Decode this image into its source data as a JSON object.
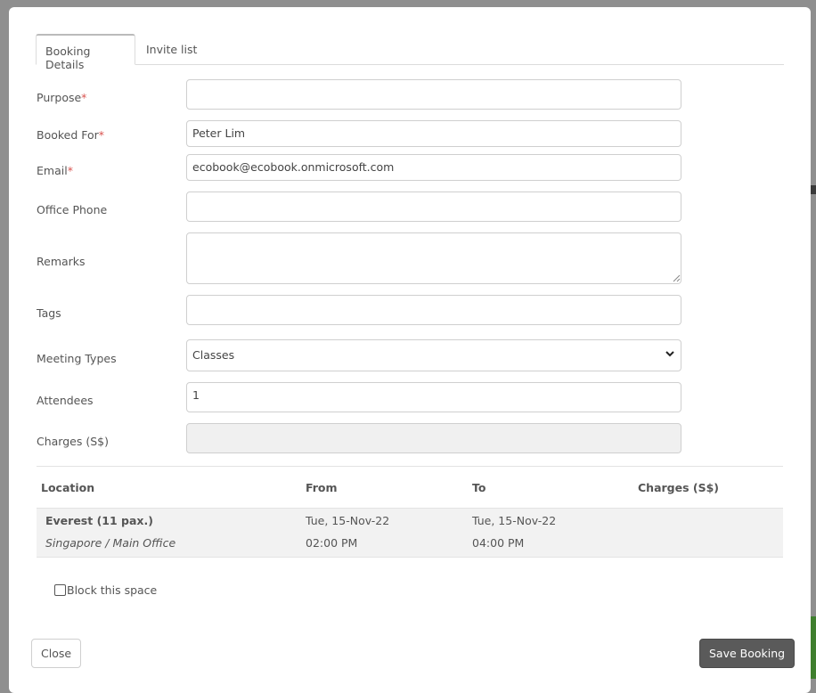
{
  "tabs": [
    {
      "label": "Booking Details",
      "active": true
    },
    {
      "label": "Invite list",
      "active": false
    }
  ],
  "form": {
    "purpose": {
      "label": "Purpose",
      "required": "*",
      "value": ""
    },
    "booked_for": {
      "label": "Booked For",
      "required": "*",
      "value": "Peter Lim"
    },
    "email": {
      "label": "Email",
      "required": "*",
      "value": "ecobook@ecobook.onmicrosoft.com"
    },
    "office_phone": {
      "label": "Office Phone",
      "value": ""
    },
    "remarks": {
      "label": "Remarks",
      "value": ""
    },
    "tags": {
      "label": "Tags",
      "value": ""
    },
    "meeting_types": {
      "label": "Meeting Types",
      "value": "Classes"
    },
    "attendees": {
      "label": "Attendees",
      "value": "1"
    },
    "charges": {
      "label": "Charges (S$)",
      "value": ""
    }
  },
  "table": {
    "headers": [
      "Location",
      "From",
      "To",
      "Charges (S$)"
    ],
    "rows": [
      {
        "location": "Everest (11 pax.)",
        "sublocation": "Singapore / Main Office",
        "from_date": "Tue, 15-Nov-22",
        "from_time": "02:00 PM",
        "to_date": "Tue, 15-Nov-22",
        "to_time": "04:00 PM",
        "charges": ""
      }
    ]
  },
  "block_space": {
    "label": "Block this space",
    "checked": false
  },
  "buttons": {
    "close": "Close",
    "save": "Save Booking"
  },
  "colors": {
    "primary_button": "#5a5a5a",
    "required": "#d9534f"
  },
  "icons": {
    "select": "chevron-down-icon"
  }
}
